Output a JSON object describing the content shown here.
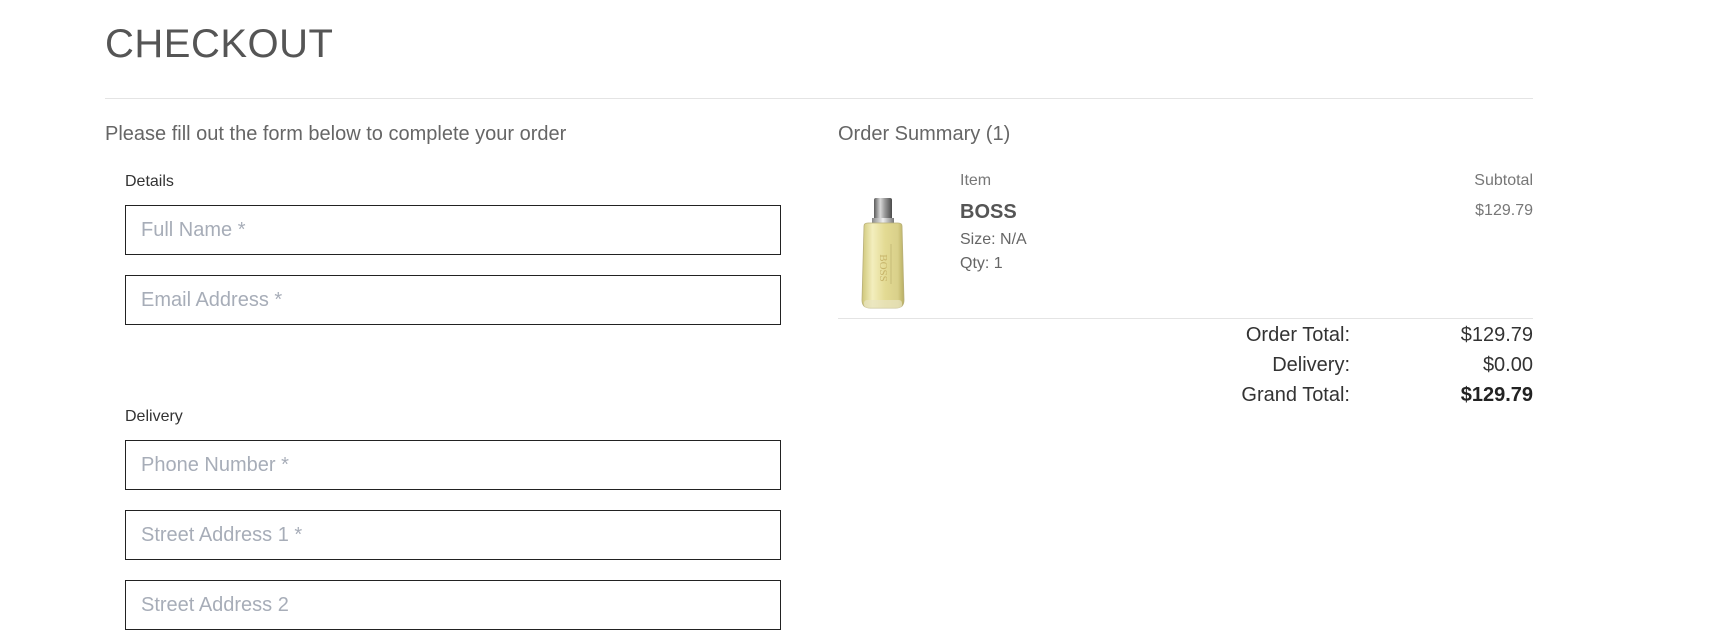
{
  "page": {
    "title": "CHECKOUT"
  },
  "form": {
    "intro": "Please fill out the form below to complete your order",
    "details": {
      "label": "Details",
      "full_name_placeholder": "Full Name *",
      "email_placeholder": "Email Address *"
    },
    "delivery": {
      "label": "Delivery",
      "phone_placeholder": "Phone Number *",
      "street1_placeholder": "Street Address 1 *",
      "street2_placeholder": "Street Address 2"
    }
  },
  "summary": {
    "title": "Order Summary (1)",
    "columns": {
      "item": "Item",
      "subtotal": "Subtotal"
    },
    "items": [
      {
        "name": "BOSS",
        "size": "Size: N/A",
        "qty": "Qty: 1",
        "price": "$129.79",
        "image_icon": "perfume-bottle-image"
      }
    ],
    "totals": {
      "order_total_label": "Order Total:",
      "order_total_value": "$129.79",
      "delivery_label": "Delivery:",
      "delivery_value": "$0.00",
      "grand_total_label": "Grand Total:",
      "grand_total_value": "$129.79"
    }
  },
  "colors": {
    "text": "#555555",
    "placeholder": "#a7adb8",
    "field_border": "#222222",
    "divider": "#e4e4e4"
  }
}
